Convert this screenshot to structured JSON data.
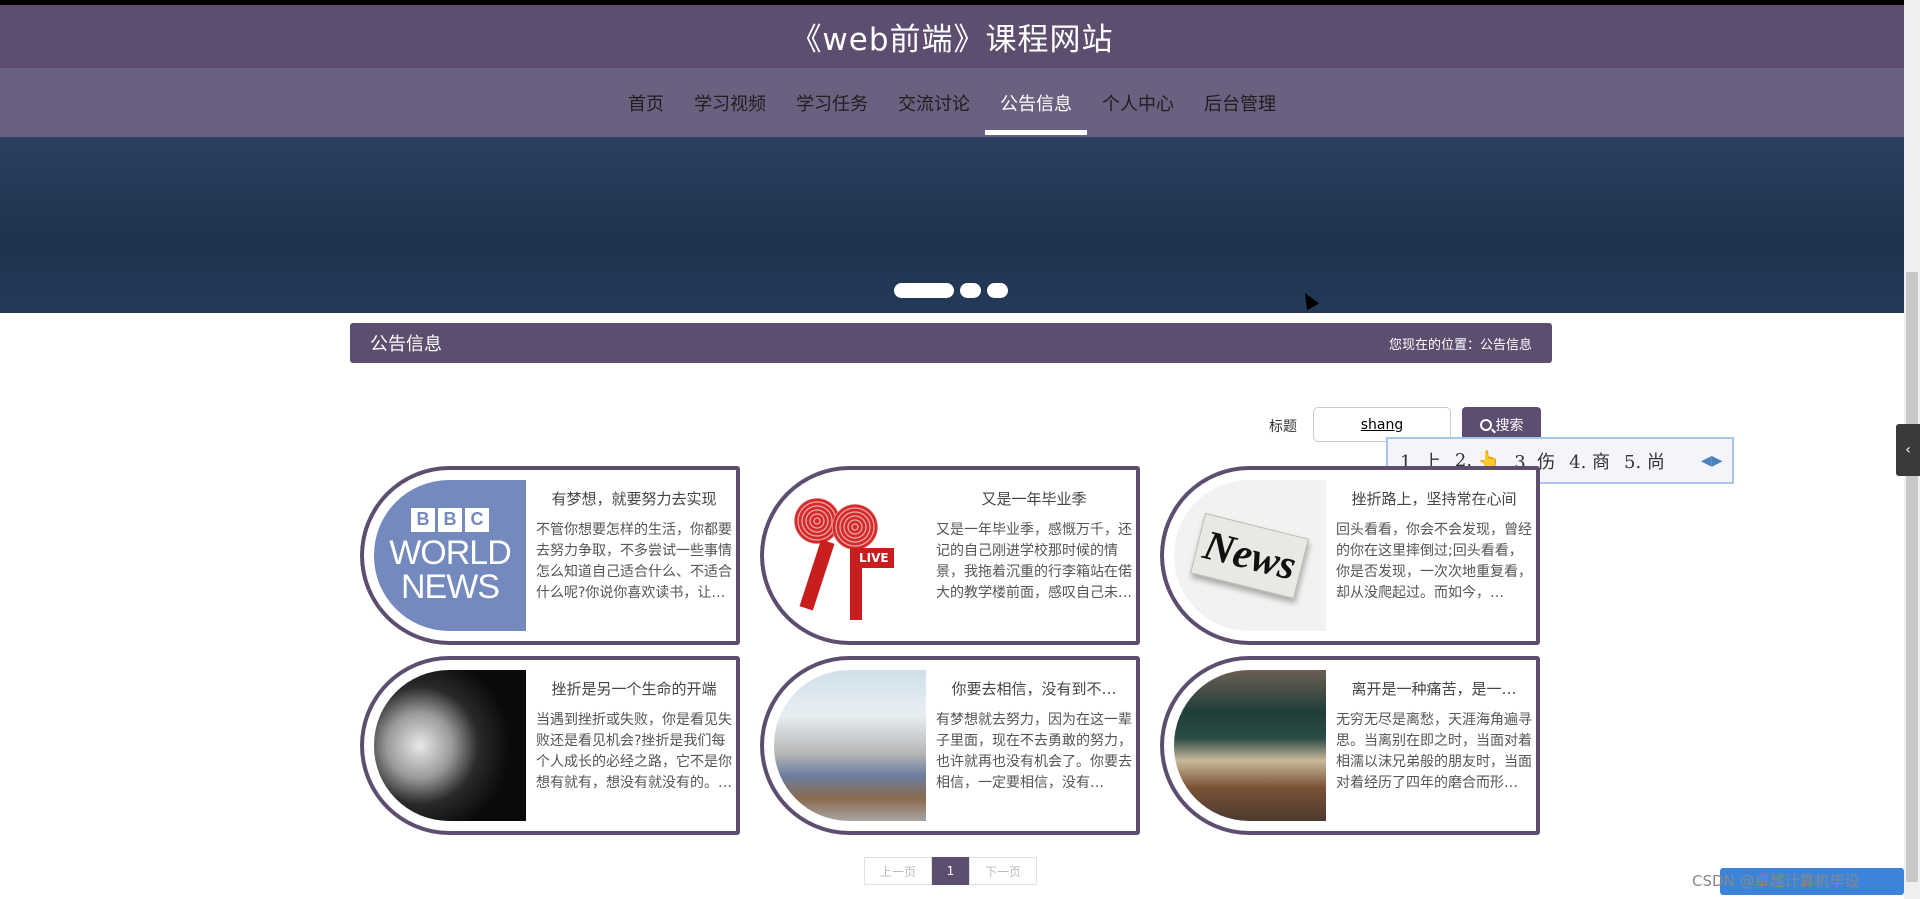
{
  "header": {
    "title": "《web前端》课程网站"
  },
  "nav": {
    "items": [
      {
        "label": "首页"
      },
      {
        "label": "学习视频"
      },
      {
        "label": "学习任务"
      },
      {
        "label": "交流讨论"
      },
      {
        "label": "公告信息"
      },
      {
        "label": "个人中心"
      },
      {
        "label": "后台管理"
      }
    ],
    "active": "公告信息"
  },
  "banner": {
    "slides": 3,
    "active_slide": 1
  },
  "section": {
    "title": "公告信息",
    "breadcrumb": "您现在的位置：公告信息"
  },
  "search": {
    "label": "标题",
    "value": "shang",
    "button_label": "搜索"
  },
  "ime": {
    "candidates": [
      "1. 上",
      "2. 👆",
      "3. 伤",
      "4. 商",
      "5. 尚"
    ],
    "arrows": "◀▶"
  },
  "cards": [
    {
      "title": "有梦想，就要努力去实现",
      "text": "不管你想要怎样的生活，你都要去努力争取，不多尝试一些事情怎么知道自己适合什么、不适合什么呢?你说你喜欢读书，让…",
      "image": "bbc-world-news"
    },
    {
      "title": "又是一年毕业季",
      "text": "又是一年毕业季，感慨万千，还记的自己刚进学校那时候的情景，我拖着沉重的行李箱站在偌大的教学楼前面，感叹自己未…",
      "image": "news-microphone"
    },
    {
      "title": "挫折路上，坚持常在心间",
      "text": "回头看看，你会不会发现，曾经的你在这里摔倒过;回头看看，你是否发现，一次次地重复看，却从没爬起过。而如今，…",
      "image": "newspaper"
    },
    {
      "title": "挫折是另一个生命的开端",
      "text": "当遇到挫折或失败，你是看见失败还是看见机会?挫折是我们每个人成长的必经之路，它不是你想有就有，想没有就没有的。…",
      "image": "ai-robot"
    },
    {
      "title": "你要去相信，没有到不…",
      "text": "有梦想就去努力，因为在这一辈子里面，现在不去勇敢的努力，也许就再也没有机会了。你要去相信，一定要相信，没有…",
      "image": "school-campus"
    },
    {
      "title": "离开是一种痛苦，是一…",
      "text": "无穷无尽是离愁，天涯海角遍寻思。当离别在即之时，当面对着相濡以沫兄弟般的朋友时，当面对着经历了四年的磨合而形…",
      "image": "classroom"
    }
  ],
  "bbc": {
    "letters": [
      "B",
      "B",
      "C"
    ],
    "line1": "WORLD",
    "line2": "NEWS"
  },
  "mic": {
    "tag": "LIVE"
  },
  "newspaper": {
    "word": "News"
  },
  "pagination": {
    "prev": "上一页",
    "current": "1",
    "next": "下一页"
  },
  "side_tab": {
    "icon": "‹"
  },
  "watermark": {
    "text": "CSDN @卓越计算机毕设"
  },
  "colors": {
    "primary": "#5d4e70",
    "nav": "#6a6080",
    "banner": "#1f3350"
  }
}
